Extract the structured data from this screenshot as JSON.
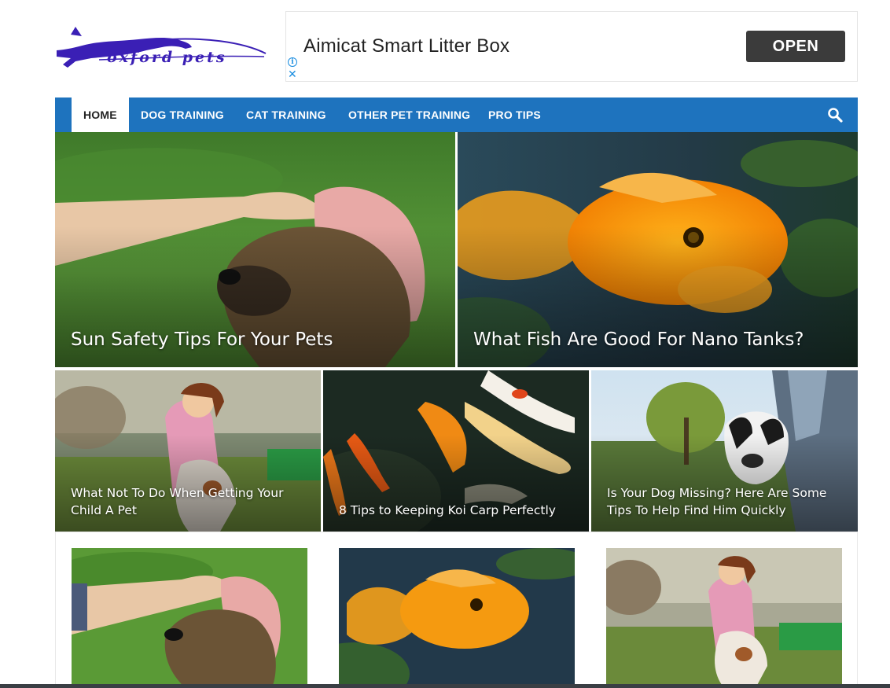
{
  "header": {
    "logo_text": "oxford pets",
    "logo_icon": "panther-logo-icon",
    "brand_color": "#3a1fb5"
  },
  "ad": {
    "title": "Aimicat Smart Litter Box",
    "button_label": "OPEN",
    "info_icon": "info-icon",
    "close_icon": "close-icon"
  },
  "nav": {
    "color": "#1e73be",
    "items": [
      {
        "label": "HOME",
        "active": true
      },
      {
        "label": "DOG TRAINING"
      },
      {
        "label": "CAT TRAINING"
      },
      {
        "label": "OTHER PET TRAINING"
      },
      {
        "label": "PRO TIPS"
      }
    ],
    "search_icon": "search-icon"
  },
  "featured": {
    "big": [
      {
        "title": "Sun Safety Tips For Your Pets",
        "image": "dog-with-cap-photo"
      },
      {
        "title": "What Fish Are Good For Nano Tanks?",
        "image": "goldfish-photo"
      }
    ],
    "small": [
      {
        "title": "What Not To Do When Getting Your Child A Pet",
        "image": "girl-with-dog-photo"
      },
      {
        "title": "8 Tips to Keeping Koi Carp Perfectly",
        "image": "koi-carp-photo"
      },
      {
        "title": "Is Your Dog Missing? Here Are Some Tips To Help Find Him Quickly",
        "image": "dog-in-car-window-photo"
      }
    ]
  },
  "posts": [
    {
      "image": "dog-with-cap-photo"
    },
    {
      "image": "goldfish-photo"
    },
    {
      "image": "girl-with-dog-photo"
    }
  ]
}
